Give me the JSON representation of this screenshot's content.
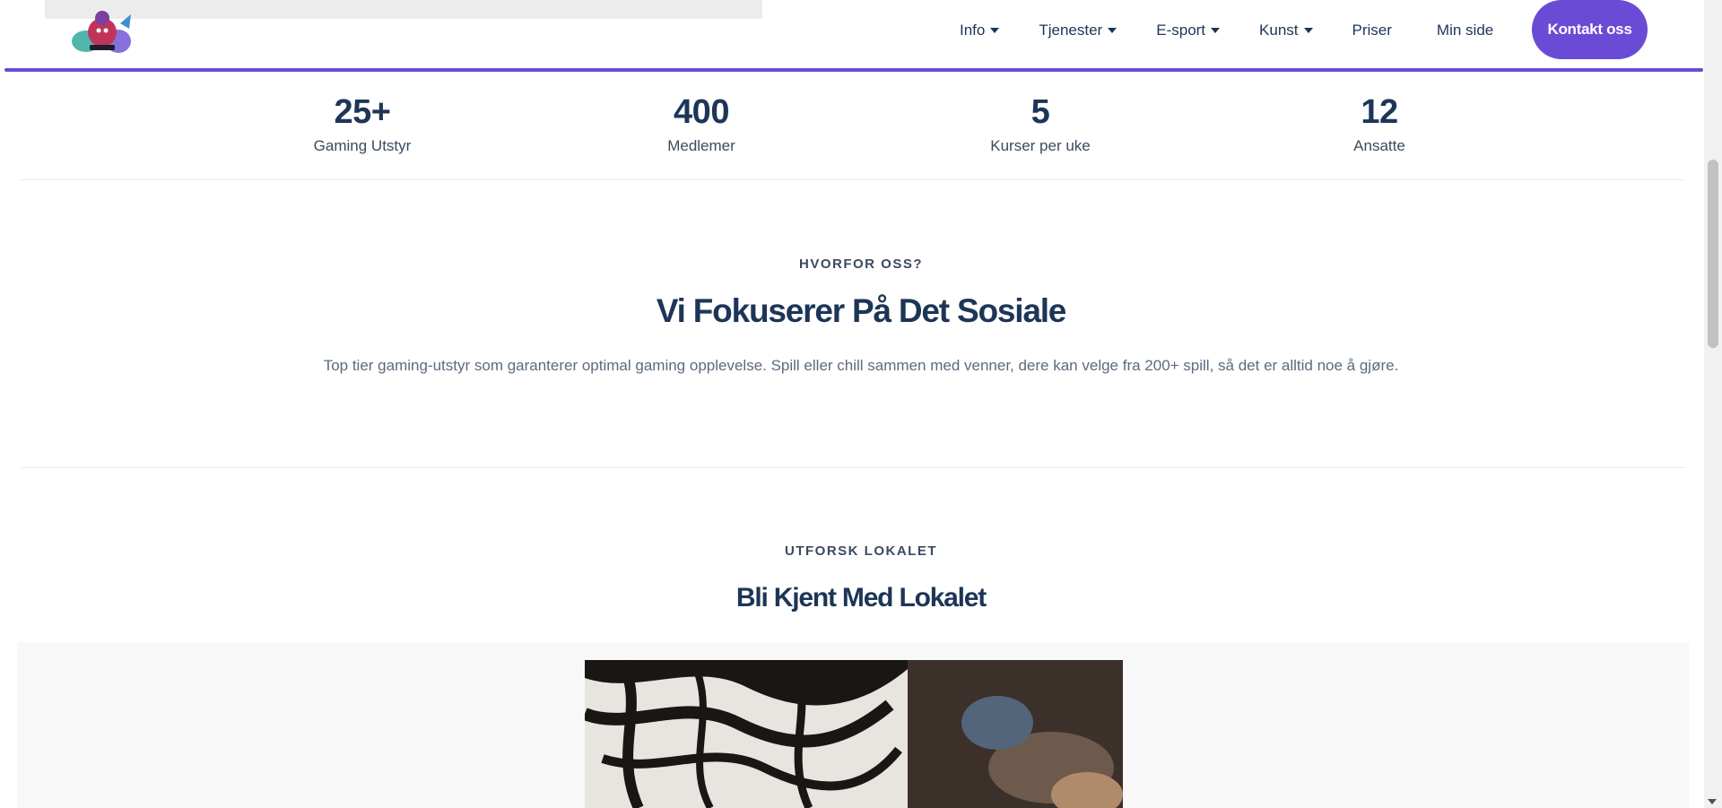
{
  "header": {
    "logo_icon": "gaming-mascot-logo",
    "nav": [
      {
        "label": "Info",
        "dropdown": true
      },
      {
        "label": "Tjenester",
        "dropdown": true
      },
      {
        "label": "E-sport",
        "dropdown": true
      },
      {
        "label": "Kunst",
        "dropdown": true
      },
      {
        "label": "Priser",
        "dropdown": false
      },
      {
        "label": "Min side",
        "dropdown": false
      }
    ],
    "cta_label": "Kontakt oss",
    "accent_color": "#6a4bd6"
  },
  "stats": [
    {
      "value": "25+",
      "label": "Gaming Utstyr"
    },
    {
      "value": "400",
      "label": "Medlemer"
    },
    {
      "value": "5",
      "label": "Kurser per uke"
    },
    {
      "value": "12",
      "label": "Ansatte"
    }
  ],
  "why": {
    "kicker": "HVORFOR OSS?",
    "heading": "Vi Fokuserer På Det Sosiale",
    "text": "Top tier gaming-utstyr som garanterer optimal gaming opplevelse. Spill eller chill sammen med venner, dere kan velge fra 200+ spill, så det er alltid noe å gjøre."
  },
  "explore": {
    "kicker": "UTFORSK LOKALET",
    "heading": "Bli Kjent Med Lokalet"
  }
}
